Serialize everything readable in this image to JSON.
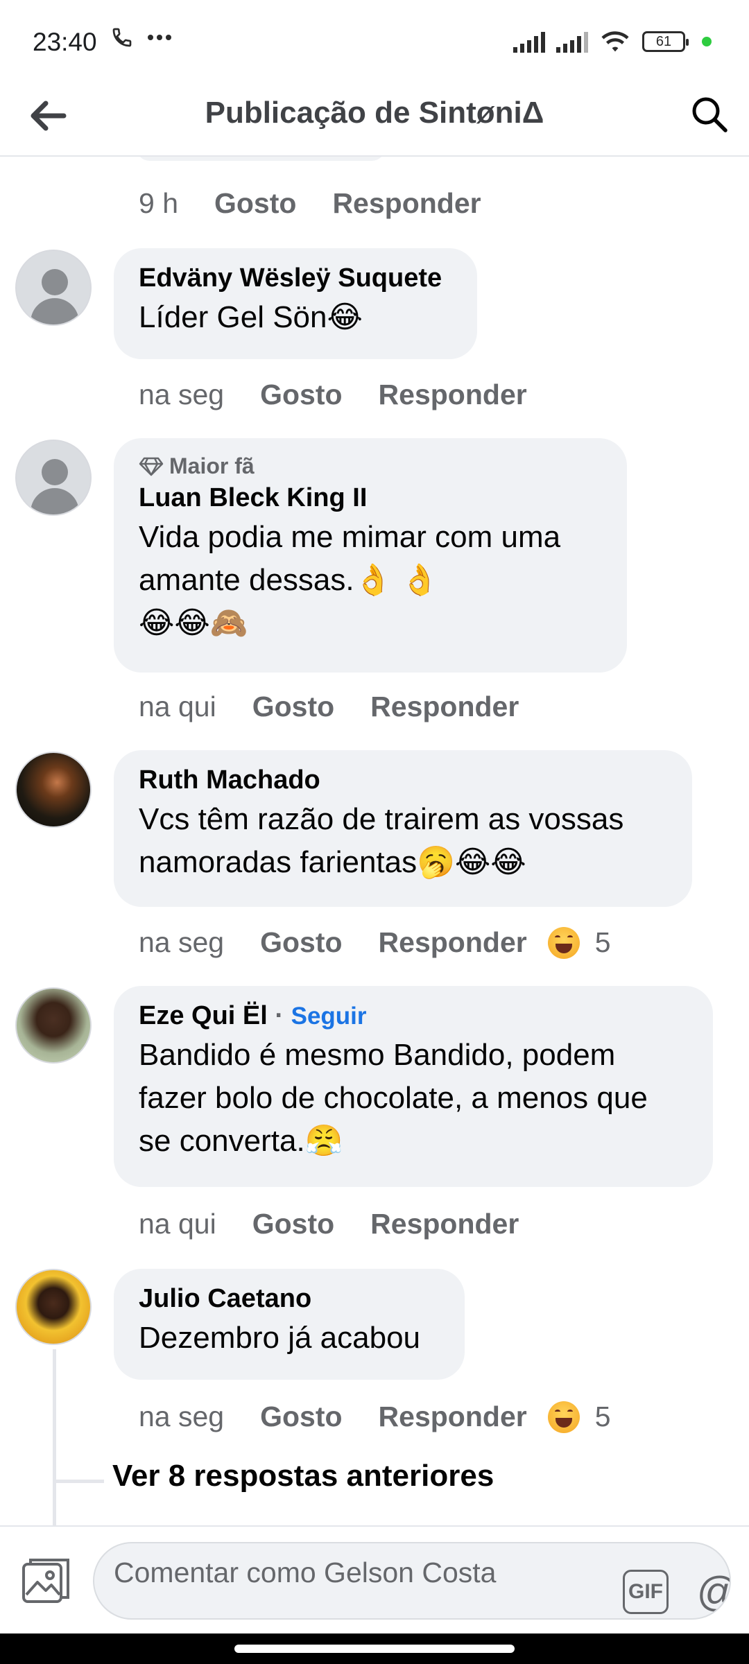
{
  "status_bar": {
    "time": "23:40",
    "battery": "61",
    "icons": [
      "phone-call-icon",
      "more-dots-icon",
      "signal-icon",
      "signal-icon",
      "wifi-icon",
      "battery-icon",
      "green-dot-icon"
    ]
  },
  "header": {
    "title": "Publicação de SintøniΔ",
    "back_icon": "arrow-left-icon",
    "search_icon": "search-icon"
  },
  "actions_labels": {
    "like": "Gosto",
    "reply": "Responder"
  },
  "top_actions": {
    "time": "9 h"
  },
  "comments": [
    {
      "author": "Edväny Wësleÿ Suquete",
      "text": "Líder Gel Sön😂",
      "time": "na seg",
      "avatar": "default-avatar"
    },
    {
      "badge": "Maior fã",
      "badge_icon": "diamond-icon",
      "author": "Luan Bleck King II",
      "text_line1": "Vida podia me mimar com uma",
      "text_line2": "amante dessas.👌 👌",
      "text_line3": "😂😂🙈",
      "time": "na qui",
      "avatar": "default-avatar"
    },
    {
      "author": "Ruth Machado",
      "text_line1": "Vcs têm razão de trairem as vossas",
      "text_line2": "namoradas farientas🥱😂😂",
      "time": "na seg",
      "reaction_count": "5",
      "reaction_icon": "haha-reaction-icon",
      "avatar": "photo"
    },
    {
      "author": "Eze Qui Ël",
      "separator": "·",
      "follow": "Seguir",
      "text_line1": "Bandido é mesmo Bandido, podem",
      "text_line2": "fazer bolo de chocolate, a menos que",
      "text_line3": "se converta.😤",
      "time": "na qui",
      "avatar": "photo"
    },
    {
      "author": "Julio Caetano",
      "text": "Dezembro já acabou",
      "time": "na seg",
      "reaction_count": "5",
      "reaction_icon": "haha-reaction-icon",
      "avatar": "photo"
    }
  ],
  "view_more": "Ver 8 respostas anteriores",
  "composer": {
    "placeholder": "Comentar como Gelson Costa",
    "gif_label": "GIF",
    "at_label": "@",
    "icons": [
      "photo-icon",
      "gif-icon",
      "mention-icon",
      "emoji-icon"
    ]
  }
}
